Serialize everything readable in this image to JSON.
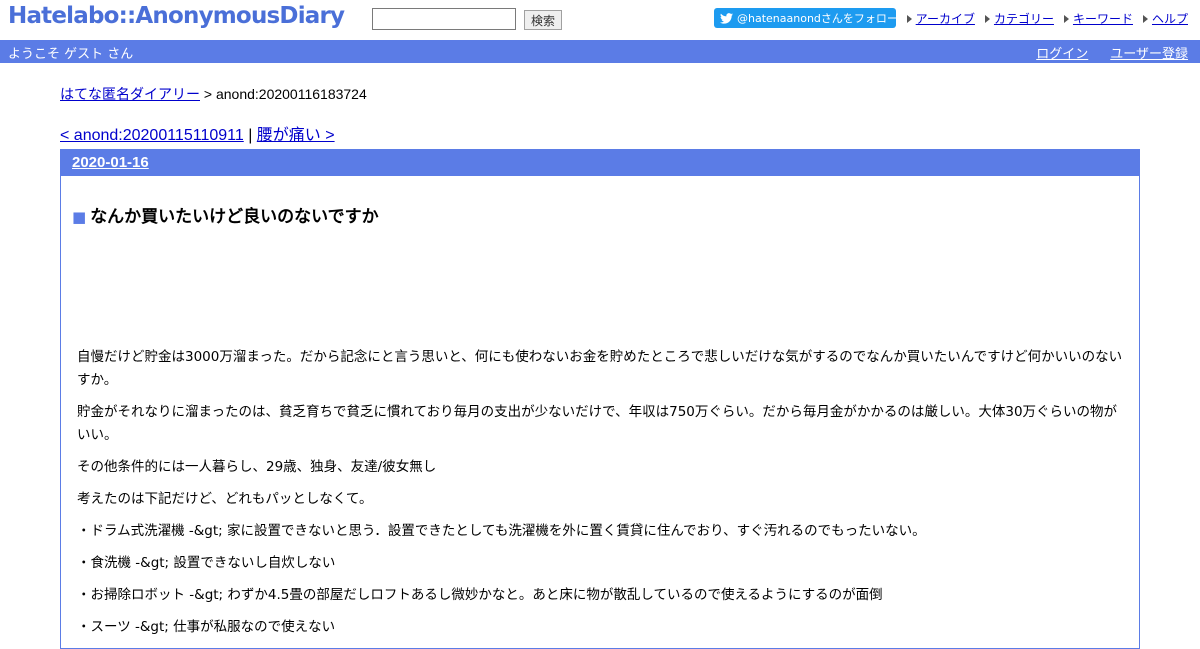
{
  "header": {
    "logo": "Hatelabo::AnonymousDiary",
    "search": {
      "value": "",
      "button_label": "検索"
    },
    "twitter_follow": "@hatenaanondさんをフォロー",
    "links": [
      "アーカイブ",
      "カテゴリー",
      "キーワード",
      "ヘルプ"
    ]
  },
  "userbar": {
    "welcome": "ようこそ ゲスト さん",
    "login": "ログイン",
    "register": "ユーザー登録"
  },
  "breadcrumb": {
    "home": "はてな匿名ダイアリー",
    "separator": " > ",
    "current": "anond:20200116183724"
  },
  "pager": {
    "prev": "< anond:20200115110911",
    "separator": " | ",
    "next": "腰が痛い >"
  },
  "day": {
    "date": "2020-01-16",
    "title_marker": "■",
    "title": "なんか買いたいけど良いのないですか",
    "paragraphs": [
      "自慢だけど貯金は3000万溜まった。だから記念にと言う思いと、何にも使わないお金を貯めたところで悲しいだけな気がするのでなんか買いたいんですけど何かいいのないすか。",
      "貯金がそれなりに溜まったのは、貧乏育ちで貧乏に慣れており毎月の支出が少ないだけで、年収は750万ぐらい。だから毎月金がかかるのは厳しい。大体30万ぐらいの物がいい。",
      "その他条件的には一人暮らし、29歳、独身、友達/彼女無し",
      "考えたのは下記だけど、どれもパッとしなくて。",
      "・ドラム式洗濯機 -&gt; 家に設置できないと思う．設置できたとしても洗濯機を外に置く賃貸に住んでおり、すぐ汚れるのでもったいない。",
      "・食洗機 -&gt; 設置できないし自炊しない",
      "・お掃除ロボット -&gt; わずか4.5畳の部屋だしロフトあるし微妙かなと。あと床に物が散乱しているので使えるようにするのが面倒",
      "・スーツ -&gt; 仕事が私服なので使えない"
    ]
  }
}
